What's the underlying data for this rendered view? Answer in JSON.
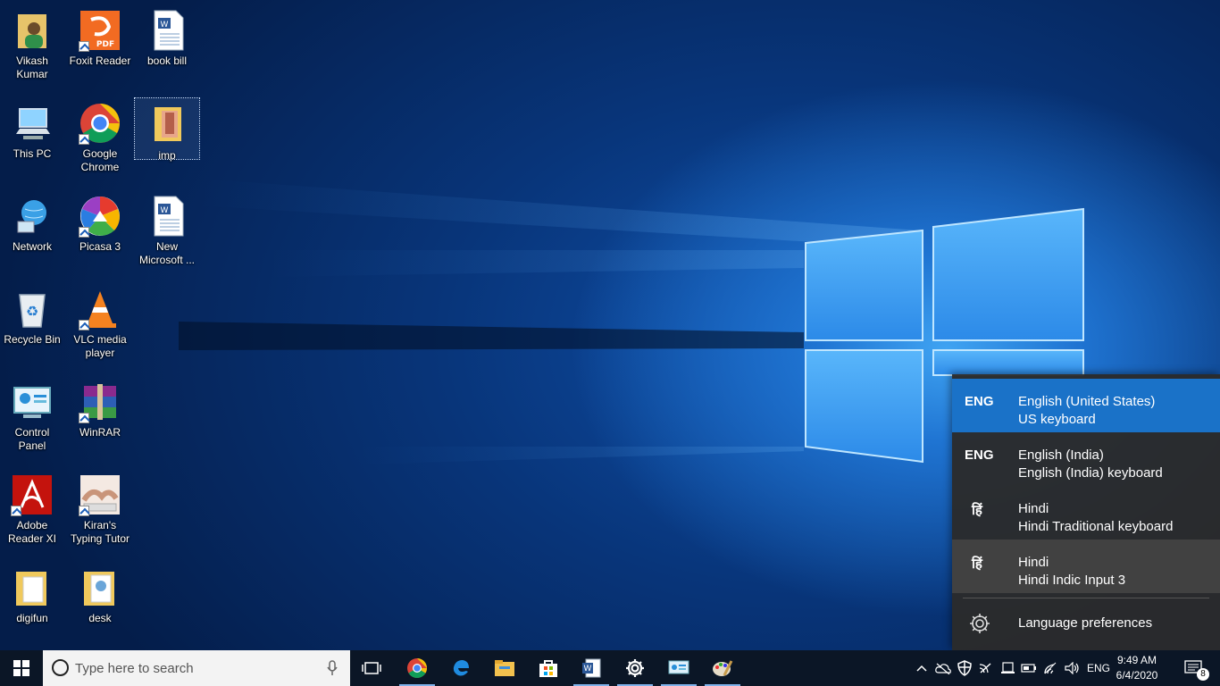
{
  "desktop": {
    "icons": [
      {
        "label": "Vikash\nKumar",
        "icon": "user-folder-icon"
      },
      {
        "label": "Foxit Reader",
        "icon": "foxit-reader-icon"
      },
      {
        "label": "book bill",
        "icon": "word-document-icon"
      },
      {
        "label": "This PC",
        "icon": "computer-icon"
      },
      {
        "label": "Google\nChrome",
        "icon": "chrome-icon"
      },
      {
        "label": "imp",
        "icon": "folder-icon"
      },
      {
        "label": "Network",
        "icon": "network-icon"
      },
      {
        "label": "Picasa 3",
        "icon": "picasa-icon"
      },
      {
        "label": "New\nMicrosoft ...",
        "icon": "word-document-icon"
      },
      {
        "label": "Recycle Bin",
        "icon": "recycle-bin-icon"
      },
      {
        "label": "VLC media\nplayer",
        "icon": "vlc-icon"
      },
      {
        "label": "Control\nPanel",
        "icon": "control-panel-icon"
      },
      {
        "label": "WinRAR",
        "icon": "winrar-icon"
      },
      {
        "label": "Adobe\nReader XI",
        "icon": "adobe-reader-icon"
      },
      {
        "label": "Kiran's\nTyping Tutor",
        "icon": "typing-tutor-icon"
      },
      {
        "label": "digifun",
        "icon": "folder-icon"
      },
      {
        "label": "desk",
        "icon": "folder-icon"
      }
    ]
  },
  "language_flyout": {
    "items": [
      {
        "code": "ENG",
        "name": "English (United States)",
        "keyboard": "US keyboard",
        "state": "selected"
      },
      {
        "code": "ENG",
        "name": "English (India)",
        "keyboard": "English (India) keyboard",
        "state": "normal"
      },
      {
        "code": "हिं",
        "name": "Hindi",
        "keyboard": "Hindi Traditional keyboard",
        "state": "normal"
      },
      {
        "code": "हिं",
        "name": "Hindi",
        "keyboard": "Hindi Indic Input 3",
        "state": "hover"
      }
    ],
    "preferences_label": "Language preferences",
    "accent_color": "#1a72c8"
  },
  "taskbar": {
    "search_placeholder": "Type here to search",
    "pinned": [
      "task-view-icon",
      "chrome-icon",
      "edge-icon",
      "file-explorer-icon",
      "store-icon",
      "word-icon",
      "settings-icon",
      "control-panel-icon",
      "paint-icon"
    ],
    "tray": {
      "language": "ENG",
      "time": "9:49 AM",
      "date": "6/4/2020",
      "notifications": "8"
    }
  }
}
